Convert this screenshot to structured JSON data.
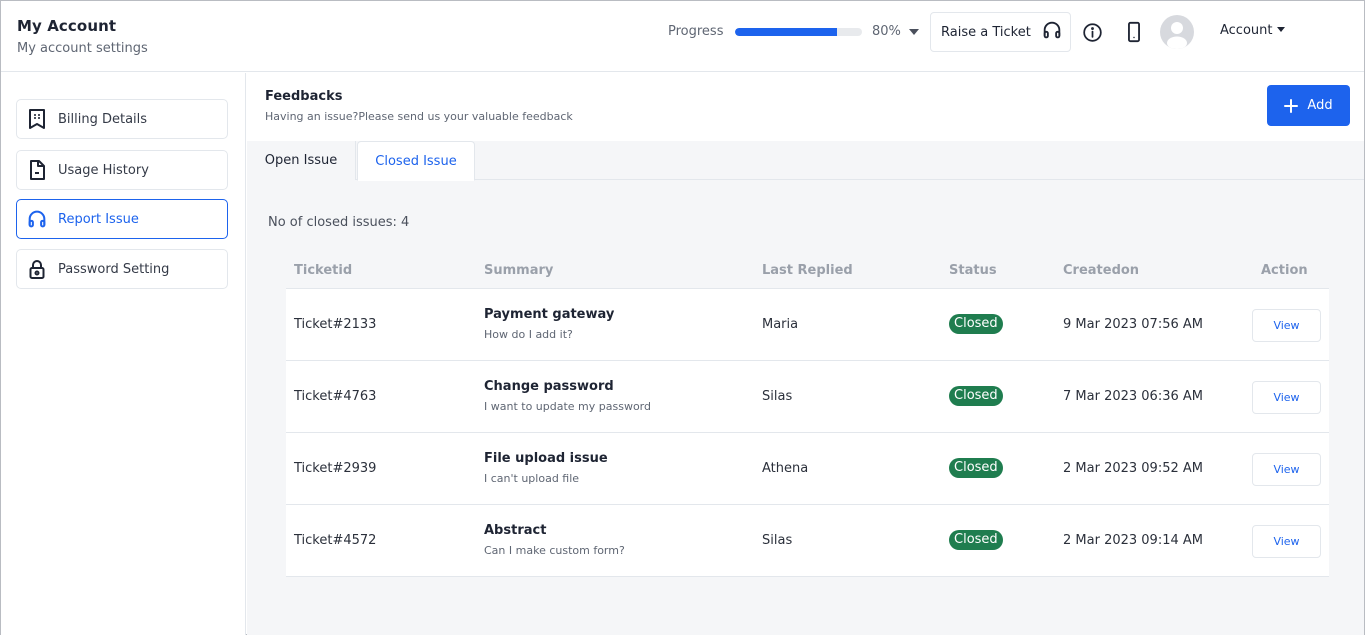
{
  "header": {
    "title": "My Account",
    "subtitle": "My account settings",
    "progress": {
      "label": "Progress",
      "value": 80,
      "display": "80%"
    },
    "raise_ticket_label": "Raise a Ticket",
    "account_label": "Account"
  },
  "sidebar": {
    "items": [
      {
        "label": "Billing Details",
        "icon": "receipt-icon",
        "active": false
      },
      {
        "label": "Usage History",
        "icon": "document-icon",
        "active": false
      },
      {
        "label": "Report Issue",
        "icon": "headphones-icon",
        "active": true
      },
      {
        "label": "Password Setting",
        "icon": "lock-icon",
        "active": false
      }
    ]
  },
  "main": {
    "title": "Feedbacks",
    "subtitle": "Having an issue?Please send us your valuable feedback",
    "add_label": "Add",
    "tabs": [
      {
        "label": "Open Issue",
        "active": false
      },
      {
        "label": "Closed Issue",
        "active": true
      }
    ],
    "count_text": "No of closed issues: 4",
    "table": {
      "columns": [
        "Ticketid",
        "Summary",
        "Last Replied",
        "Status",
        "Createdon",
        "Action"
      ],
      "rows": [
        {
          "id": "Ticket#2133",
          "summary_title": "Payment gateway",
          "summary_desc": "How do I add it?",
          "last_replied": "Maria",
          "status": "Closed",
          "created": "9 Mar 2023 07:56 AM",
          "action": "View"
        },
        {
          "id": "Ticket#4763",
          "summary_title": "Change password",
          "summary_desc": "I want to update my password",
          "last_replied": "Silas",
          "status": "Closed",
          "created": "7 Mar 2023 06:36 AM",
          "action": "View"
        },
        {
          "id": "Ticket#2939",
          "summary_title": "File upload issue",
          "summary_desc": "I can't upload file",
          "last_replied": "Athena",
          "status": "Closed",
          "created": "2 Mar 2023 09:52 AM",
          "action": "View"
        },
        {
          "id": "Ticket#4572",
          "summary_title": "Abstract",
          "summary_desc": "Can I make custom form?",
          "last_replied": "Silas",
          "status": "Closed",
          "created": "2 Mar 2023 09:14 AM",
          "action": "View"
        }
      ]
    }
  },
  "colors": {
    "accent": "#1d63ed",
    "status_closed": "#1f7d4f"
  }
}
